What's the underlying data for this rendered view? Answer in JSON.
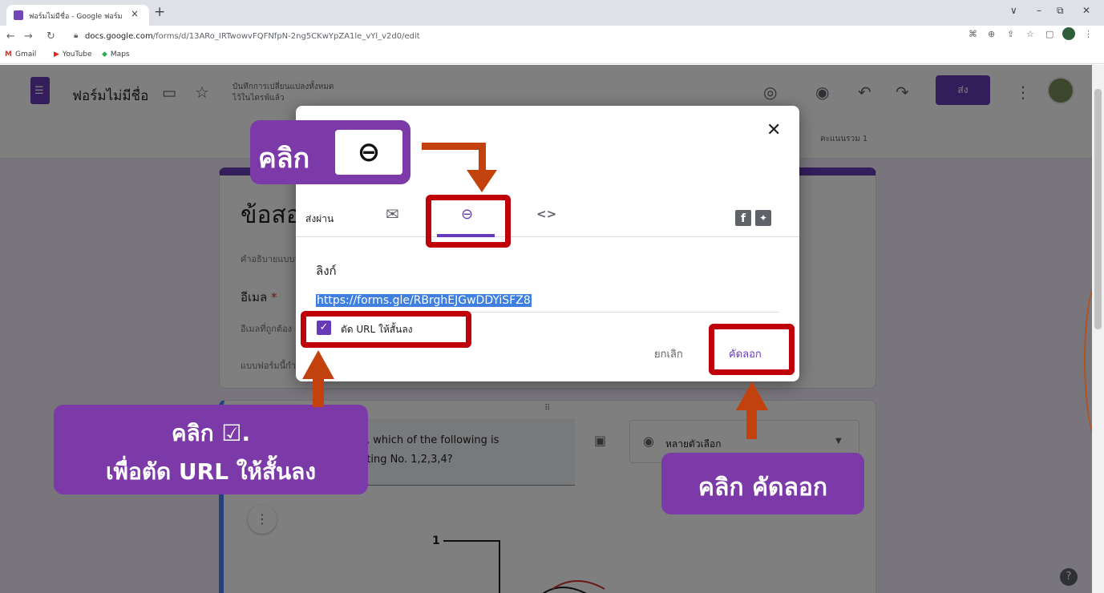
{
  "browser": {
    "tab_title": "ฟอร์มไม่มีชื่อ - Google ฟอร์ม",
    "tab_close": "×",
    "new_tab": "+",
    "url_host": "docs.google.com",
    "url_path": "/forms/d/13ARo_IRTwowvFQFNfpN-2ng5CKwYpZA1le_vYl_v2d0/edit",
    "bookmarks": [
      "Gmail",
      "YouTube",
      "Maps"
    ],
    "window_controls": [
      "∨",
      "–",
      "⧉",
      "✕"
    ]
  },
  "form_header": {
    "title": "ฟอร์มไม่มีชื่อ",
    "save_status": "บันทึกการเปลี่ยนแปลงทั้งหมด\nไว้ในไดรฟ์แล้ว",
    "send_label": "ส่ง",
    "score_label": "คะแนนรวม 1"
  },
  "form_body": {
    "card_title": "ข้อสอบ",
    "card_desc": "คำอธิบายแบบฟอร์ม",
    "email_label": "อีเมล",
    "required_mark": "*",
    "email_placeholder": "อีเมลที่ถูกต้อง",
    "form_type": "แบบฟอร์มนี้กำลังรวบรวมอีเมล",
    "question_text": "e, which of the following is\nnting No. 1,2,3,4?",
    "question_type": "หลายตัวเลือก",
    "diagram_label": "1"
  },
  "dialog": {
    "send_via": "ส่งผ่าน",
    "link_title": "ลิงก์",
    "url": "https://forms.gle/RBrghEJGwDDYiSFZ8",
    "shorten_label": "ตัด URL ให้สั้นลง",
    "cancel_label": "ยกเลิก",
    "copy_label": "คัดลอก",
    "embed_label": "<>",
    "fb_label": "f"
  },
  "annotations": {
    "click_link": "คลิก",
    "click_check_line1": "คลิก ☑.",
    "click_check_line2": "เพื่อตัด URL ให้สั้นลง",
    "click_copy": "คลิก คัดลอก"
  },
  "colors": {
    "accent": "#673ab7",
    "annotation_red": "#c0000a",
    "callout_purple": "#7b3aa8",
    "arrow_orange": "#c2410c"
  },
  "icons": [
    "link-icon",
    "mail-icon",
    "close-icon",
    "folder-icon",
    "star-icon",
    "palette-icon",
    "eye-icon",
    "undo-icon",
    "redo-icon",
    "more-vert-icon",
    "image-icon",
    "radio-icon",
    "facebook-icon",
    "twitter-icon"
  ]
}
